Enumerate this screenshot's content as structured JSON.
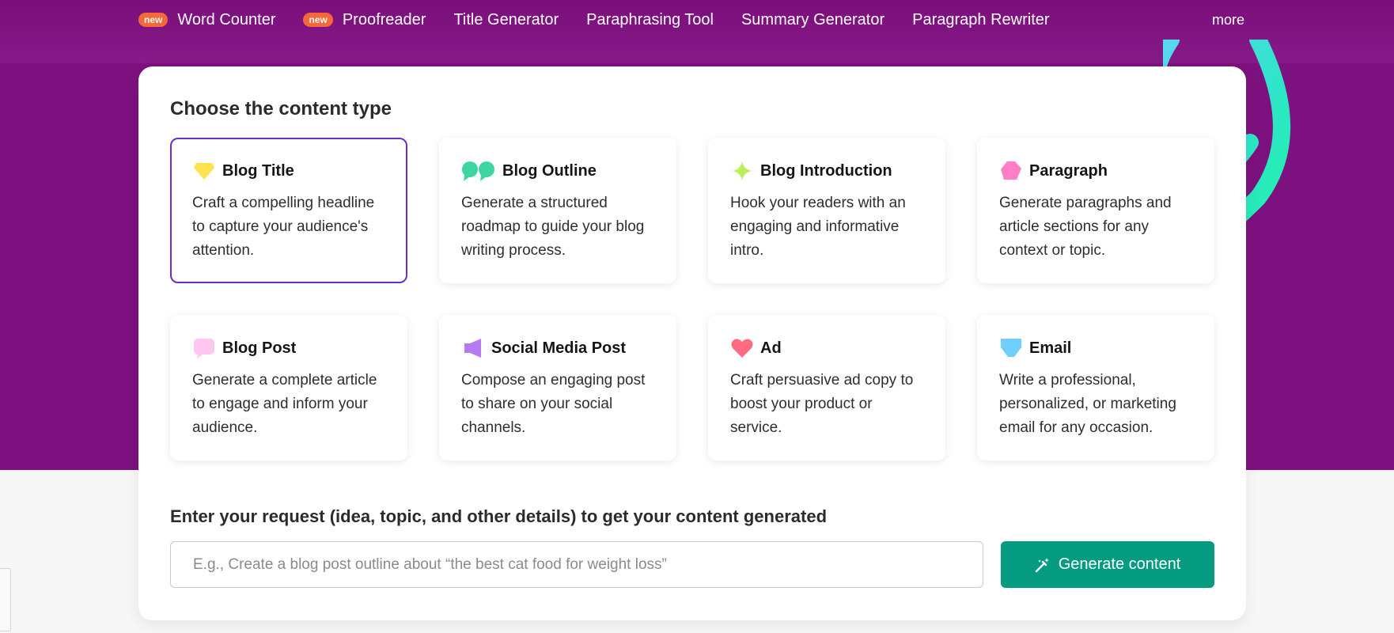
{
  "nav": {
    "items": [
      {
        "label": "Word Counter",
        "badge": "new"
      },
      {
        "label": "Proofreader",
        "badge": "new"
      },
      {
        "label": "Title Generator",
        "badge": ""
      },
      {
        "label": "Paraphrasing Tool",
        "badge": ""
      },
      {
        "label": "Summary Generator",
        "badge": ""
      },
      {
        "label": "Paragraph Rewriter",
        "badge": ""
      }
    ],
    "more": "more"
  },
  "content_type": {
    "title": "Choose the content type",
    "selected": "Blog Title",
    "cards": [
      {
        "title": "Blog Title",
        "desc": "Craft a compelling headline to capture your audience's attention.",
        "icon": "diamond-icon",
        "color": "#ffe34d"
      },
      {
        "title": "Blog Outline",
        "desc": "Generate a structured roadmap to guide your blog writing process.",
        "icon": "speech-bubbles-icon",
        "color": "#3ed6a0"
      },
      {
        "title": "Blog Introduction",
        "desc": "Hook your readers with an engaging and informative intro.",
        "icon": "sparkle-icon",
        "color": "#b9ef5c"
      },
      {
        "title": "Paragraph",
        "desc": "Generate paragraphs and article sections for any context or topic.",
        "icon": "pentagon-icon",
        "color": "#ff7fc6"
      },
      {
        "title": "Blog Post",
        "desc": "Generate a complete article to engage and inform your audience.",
        "icon": "chat-bubble-icon",
        "color": "#ffc6f0"
      },
      {
        "title": "Social Media Post",
        "desc": "Compose an engaging post to share on your social channels.",
        "icon": "megaphone-icon",
        "color": "#b47cf0"
      },
      {
        "title": "Ad",
        "desc": "Craft persuasive ad copy to boost your product or service.",
        "icon": "heart-icon",
        "color": "#ff6b81"
      },
      {
        "title": "Email",
        "desc": "Write a professional, personalized, or marketing email for any occasion.",
        "icon": "envelope-icon",
        "color": "#6fd0ff"
      }
    ]
  },
  "request": {
    "label": "Enter your request (idea, topic, and other details) to get your content generated",
    "placeholder": "E.g., Create a blog post outline about “the best cat food for weight loss”",
    "value": ""
  },
  "generate_button": {
    "label": "Generate content"
  },
  "colors": {
    "hero": "#7d117f",
    "accent_green": "#049b80",
    "selected_border": "#6a2fc8",
    "badge": "#f4683a"
  }
}
